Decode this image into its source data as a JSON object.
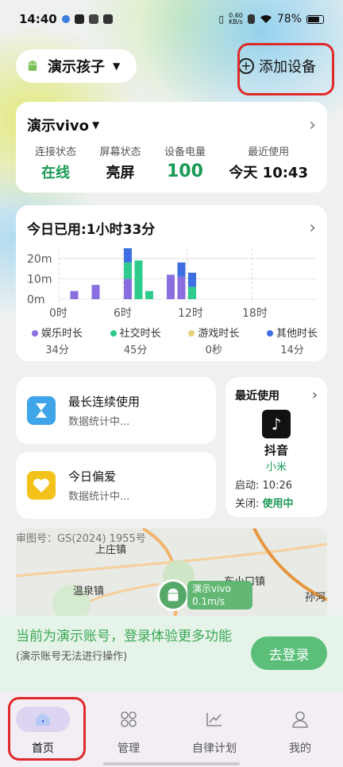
{
  "status_bar": {
    "time": "14:40",
    "speed_value": "0.60",
    "speed_unit": "KB/s",
    "battery": "78%"
  },
  "header": {
    "child_name": "演示孩子",
    "add_device_label": "添加设备"
  },
  "device_card": {
    "name": "演示vivo",
    "stats": [
      {
        "label": "连接状态",
        "value": "在线",
        "color": "#1a9a55"
      },
      {
        "label": "屏幕状态",
        "value": "亮屏",
        "color": "#111111"
      },
      {
        "label": "设备电量",
        "value": "100",
        "color": "#1a9a55"
      },
      {
        "label": "最近使用",
        "value": "今天 10:43",
        "color": "#111111"
      }
    ]
  },
  "usage_card": {
    "title": "今日已用:1小时33分",
    "chart_data": {
      "type": "bar",
      "title": "今日已用:1小时33分",
      "y_tick_labels": [
        "20m",
        "10m",
        "0m"
      ],
      "x_tick_labels": [
        "0时",
        "6时",
        "12时",
        "18时"
      ],
      "ylim": [
        0,
        25
      ],
      "hours_range": [
        0,
        24
      ],
      "series": [
        {
          "name": "娱乐时长",
          "color": "#8a6ee0",
          "values": [
            [
              1,
              4
            ],
            [
              3,
              7
            ],
            [
              6,
              10
            ],
            [
              8,
              0
            ],
            [
              9,
              0
            ],
            [
              10,
              12
            ],
            [
              11,
              11
            ],
            [
              12,
              0
            ]
          ]
        },
        {
          "name": "社交时长",
          "color": "#2ecb8c",
          "values": [
            [
              1,
              0
            ],
            [
              3,
              0
            ],
            [
              6,
              8
            ],
            [
              7,
              19
            ],
            [
              8,
              4
            ],
            [
              10,
              0
            ],
            [
              11,
              0
            ],
            [
              12,
              6
            ]
          ]
        },
        {
          "name": "游戏时长",
          "color": "#e8d27a",
          "values": []
        },
        {
          "name": "其他时长",
          "color": "#3e6fe0",
          "values": [
            [
              6,
              7
            ],
            [
              11,
              7
            ],
            [
              12,
              7
            ]
          ]
        }
      ]
    },
    "legend": [
      {
        "name": "娱乐时长",
        "color": "#8a6ee0",
        "value": "34分"
      },
      {
        "name": "社交时长",
        "color": "#2ecb8c",
        "value": "45分"
      },
      {
        "name": "游戏时长",
        "color": "#e8d27a",
        "value": "0秒"
      },
      {
        "name": "其他时长",
        "color": "#3e6fe0",
        "value": "14分"
      }
    ]
  },
  "longest_use": {
    "title": "最长连续使用",
    "subtitle": "数据统计中..."
  },
  "favorite": {
    "title": "今日偏爱",
    "subtitle": "数据统计中..."
  },
  "recent": {
    "title": "最近使用",
    "app_name": "抖音",
    "vendor": "小米",
    "start_label": "启动:",
    "start_time": "10:26",
    "close_label": "关闭:",
    "close_value": "使用中"
  },
  "map": {
    "copyright": "审图号：GS(2024) 1955号",
    "places": [
      "上庄镇",
      "温泉镇",
      "东小口镇",
      "孙河"
    ],
    "pin_device": "演示vivo",
    "pin_speed": "0.1m/s"
  },
  "login_banner": {
    "title": "当前为演示账号，登录体验更多功能",
    "subtitle": "(演示账号无法进行操作)",
    "button": "去登录"
  },
  "tabs": [
    {
      "label": "首页"
    },
    {
      "label": "管理"
    },
    {
      "label": "自律计划"
    },
    {
      "label": "我的"
    }
  ]
}
